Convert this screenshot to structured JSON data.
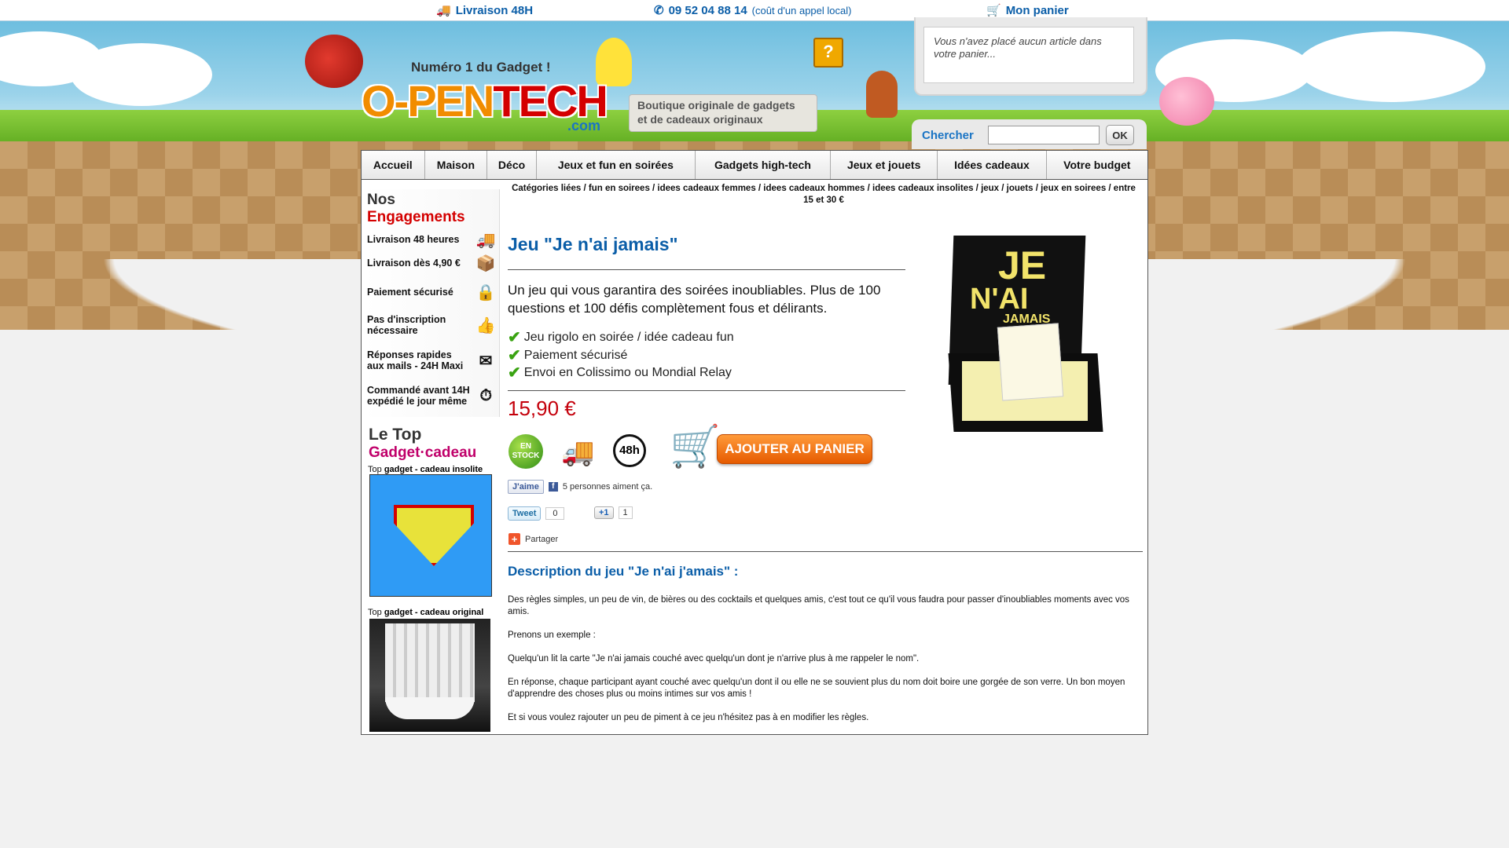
{
  "topbar": {
    "delivery": "Livraison 48H",
    "phone": "09 52 04 88 14",
    "phone_note": "(coût d'un appel local)",
    "cart": "Mon panier"
  },
  "header": {
    "tagline": "Numéro 1 du Gadget !",
    "logo_a": "O-PEN",
    "logo_b": "TECH",
    "logo_com": ".com",
    "scroll_line1": "Boutique originale de gadgets",
    "scroll_line2": "et de cadeaux originaux",
    "cart_empty": "Vous n'avez placé aucun article dans votre panier..."
  },
  "search": {
    "label": "Chercher",
    "value": "",
    "button": "OK"
  },
  "nav": [
    "Accueil",
    "Maison",
    "Déco",
    "Jeux et fun en soirées",
    "Gadgets high-tech",
    "Jeux et jouets",
    "Idées cadeaux",
    "Votre budget"
  ],
  "sidebar": {
    "eng_title_a": "Nos",
    "eng_title_b": "Engagements",
    "engagements": [
      {
        "label": "Livraison 48 heures",
        "icon": "truck-icon"
      },
      {
        "label": "Livraison dès 4,90 €",
        "icon": "package-icon"
      },
      {
        "label": "Paiement sécurisé",
        "icon": "padlock-icon"
      },
      {
        "label": "Pas d'inscription nécessaire",
        "icon": "thumbs-up-icon"
      },
      {
        "label": "Réponses rapides aux mails - 24H Maxi",
        "icon": "mail-icon"
      },
      {
        "label": "Commandé avant 14H expédié le jour même",
        "icon": "stopwatch-icon"
      }
    ],
    "top_title_a": "Le Top",
    "top_title_b": "Gadget·cadeau",
    "top1_prefix": "Top",
    "top1_bold": "gadget - cadeau insolite",
    "top2_prefix": "Top",
    "top2_bold": "gadget - cadeau original"
  },
  "breadcrumb": "Catégories liées / fun en soirees / idees cadeaux femmes / idees cadeaux hommes / idees cadeaux insolites / jeux / jouets / jeux en soirees / entre 15 et 30 €",
  "product": {
    "title": "Jeu \"Je n'ai jamais\"",
    "lead": "Un jeu qui vous garantira des soirées inoubliables. Plus de 100 questions et 100 défis complètement fous et délirants.",
    "checks": [
      "Jeu rigolo en soirée / idée cadeau fun",
      "Paiement sécurisé",
      "Envoi en Colissimo ou Mondial Relay"
    ],
    "price": "15,90 €",
    "stock_a": "EN",
    "stock_b": "STOCK",
    "badge_48": "48h",
    "add_to_cart": "AJOUTER AU PANIER",
    "box_je": "JE",
    "box_nai": "N'AI",
    "box_jamais": "JAMAIS"
  },
  "social": {
    "like": "J'aime",
    "like_count": "5 personnes aiment ça.",
    "tweet": "Tweet",
    "tweet_count": "0",
    "plusone": "+1",
    "plusone_count": "1",
    "share": "Partager"
  },
  "description": {
    "title": "Description du jeu \"Je n'ai j'amais\" :",
    "paragraphs": [
      "Des règles simples, un peu de vin, de bières ou des cocktails et quelques amis, c'est tout ce qu'il vous faudra pour passer d'inoubliables moments avec vos amis.",
      "Prenons un exemple :",
      "Quelqu'un lit la carte \"Je n'ai jamais couché avec quelqu'un dont je n'arrive plus à me rappeler le nom\".",
      "En réponse, chaque participant ayant couché avec quelqu'un dont il ou elle ne se souvient plus du nom doit boire une gorgée de son verre. Un bon moyen d'apprendre des choses plus ou moins intimes sur vos amis !",
      "Et si vous voulez rajouter un peu de piment à ce jeu n'hésitez pas à en modifier les règles."
    ]
  },
  "colors": {
    "link_blue": "#0b5ea8",
    "price_red": "#c4000b",
    "cart_orange": "#e65b00"
  }
}
